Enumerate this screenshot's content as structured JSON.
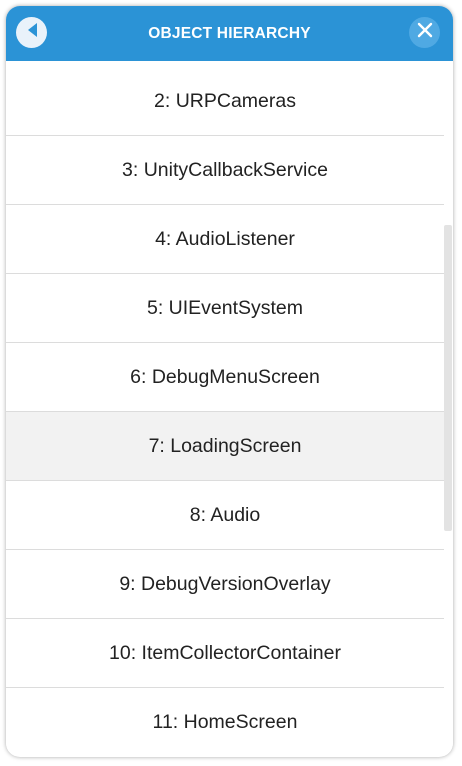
{
  "header": {
    "title": "OBJECT HIERARCHY",
    "back_icon": "back-arrow-icon",
    "close_icon": "close-icon"
  },
  "colors": {
    "header_bg": "#2b93d6",
    "highlight_row": "#f2f2f2"
  },
  "list": {
    "items": [
      {
        "label": "2: URPCameras"
      },
      {
        "label": "3: UnityCallbackService"
      },
      {
        "label": "4: AudioListener"
      },
      {
        "label": "5: UIEventSystem"
      },
      {
        "label": "6: DebugMenuScreen"
      },
      {
        "label": "7: LoadingScreen",
        "highlighted": true
      },
      {
        "label": "8: Audio"
      },
      {
        "label": "9: DebugVersionOverlay"
      },
      {
        "label": "10: ItemCollectorContainer"
      },
      {
        "label": "11: HomeScreen"
      }
    ]
  }
}
